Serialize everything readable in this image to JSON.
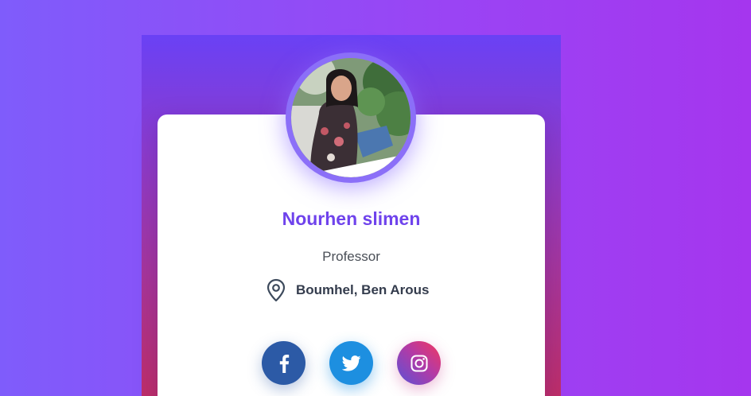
{
  "profile": {
    "name": "Nourhen slimen",
    "role": "Professor",
    "location": "Boumhel, Ben Arous"
  },
  "social": [
    {
      "network": "facebook",
      "icon": "facebook-icon",
      "color": "#2c5aa6"
    },
    {
      "network": "twitter",
      "icon": "twitter-icon",
      "color": "#1d8fe0"
    },
    {
      "network": "instagram",
      "icon": "instagram-icon",
      "color": "#c8379a"
    }
  ],
  "colors": {
    "accent": "#6f43ec",
    "background": "#9a44f4"
  }
}
